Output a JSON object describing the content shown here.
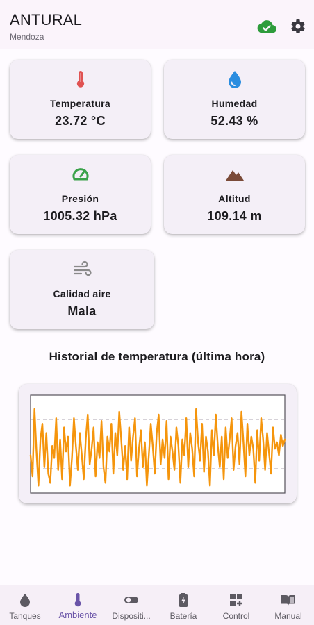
{
  "appbar": {
    "title": "ANTURAL",
    "subtitle": "Mendoza",
    "cloud_icon": "cloud-done-icon",
    "settings_icon": "gear-icon",
    "cloud_color": "#2e9c3c"
  },
  "cards": [
    {
      "label": "Temperatura",
      "value": "23.72 °C",
      "icon": "thermometer-icon",
      "color": "#e05252"
    },
    {
      "label": "Humedad",
      "value": "52.43 %",
      "icon": "water-drop-icon",
      "color": "#2a8de0"
    },
    {
      "label": "Presión",
      "value": "1005.32 hPa",
      "icon": "speedometer-icon",
      "color": "#3aa24a"
    },
    {
      "label": "Altitud",
      "value": "109.14 m",
      "icon": "mountain-icon",
      "color": "#7a4a38"
    },
    {
      "label": "Calidad aire",
      "value": "Mala",
      "icon": "wind-icon",
      "color": "#8a8a8a"
    }
  ],
  "history": {
    "title": "Historial de temperatura (última hora)"
  },
  "chart_data": {
    "type": "line",
    "title": "Historial de temperatura (última hora)",
    "series": [
      {
        "color": "#f5950c",
        "values": [
          0.38,
          0.15,
          0.88,
          0.42,
          0.05,
          0.55,
          0.72,
          0.25,
          0.62,
          0.18,
          0.08,
          0.48,
          0.35,
          0.78,
          0.22,
          0.55,
          0.12,
          0.68,
          0.42,
          0.58,
          0.05,
          0.35,
          0.78,
          0.48,
          0.22,
          0.62,
          0.38,
          0.12,
          0.55,
          0.82,
          0.28,
          0.45,
          0.68,
          0.15,
          0.52,
          0.35,
          0.75,
          0.25,
          0.08,
          0.58,
          0.42,
          0.72,
          0.18,
          0.62,
          0.38,
          0.85,
          0.55,
          0.22,
          0.48,
          0.12,
          0.68,
          0.32,
          0.58,
          0.78,
          0.15,
          0.45,
          0.65,
          0.25,
          0.52,
          0.05,
          0.38,
          0.72,
          0.48,
          0.18,
          0.62,
          0.82,
          0.28,
          0.55,
          0.35,
          0.75,
          0.12,
          0.58,
          0.42,
          0.22,
          0.68,
          0.48,
          0.08,
          0.55,
          0.38,
          0.78,
          0.25,
          0.62,
          0.45,
          0.15,
          0.88,
          0.52,
          0.32,
          0.72,
          0.2,
          0.58,
          0.42,
          0.05,
          0.65,
          0.38,
          0.82,
          0.48,
          0.25,
          0.58,
          0.12,
          0.68,
          0.35,
          0.55,
          0.78,
          0.22,
          0.48,
          0.62,
          0.28,
          0.85,
          0.52,
          0.15,
          0.72,
          0.38,
          0.58,
          0.45,
          0.08,
          0.65,
          0.32,
          0.78,
          0.55,
          0.22,
          0.62,
          0.4,
          0.18,
          0.68,
          0.45,
          0.52,
          0.38,
          0.6,
          0.48,
          0.55
        ]
      }
    ],
    "ylim": [
      0,
      1
    ],
    "grid": "horizontal dashed"
  },
  "navbar": {
    "items": [
      {
        "label": "Tanques",
        "icon": "water-drop-icon"
      },
      {
        "label": "Ambiente",
        "icon": "thermometer-icon",
        "active": true
      },
      {
        "label": "Dispositi...",
        "icon": "toggle-icon"
      },
      {
        "label": "Batería",
        "icon": "battery-icon"
      },
      {
        "label": "Control",
        "icon": "dashboard-add-icon"
      },
      {
        "label": "Manual",
        "icon": "book-icon"
      }
    ]
  }
}
